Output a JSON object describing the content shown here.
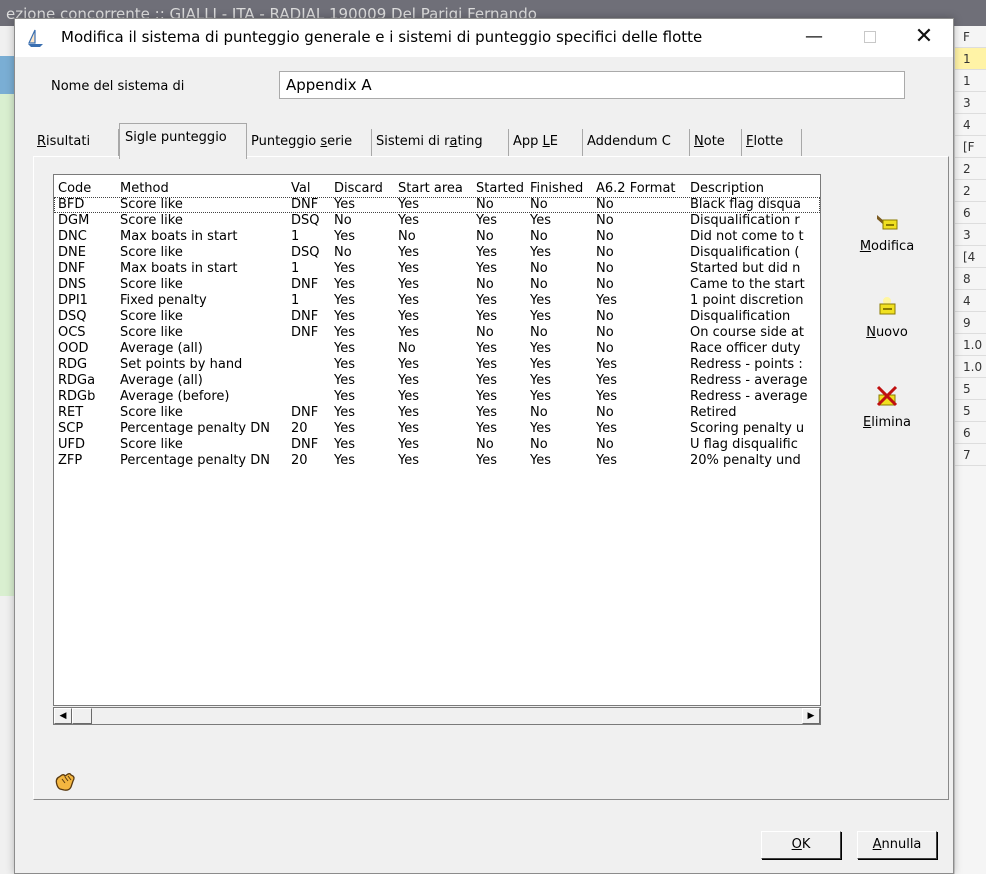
{
  "background": {
    "title": "ezione concorrente :: GIALLI - ITA - RADIAL 190009 Del Parigi Fernando",
    "right_column": [
      "F",
      "1",
      "1",
      "3",
      "4",
      "[F",
      "2",
      "2",
      "6",
      "3",
      "[4",
      "8",
      "4",
      "9",
      "1.0",
      "1.0",
      "5",
      "5",
      "6",
      "7"
    ]
  },
  "dialog": {
    "title": "Modifica il sistema di punteggio generale e i sistemi di punteggio specifici delle flotte",
    "name_label": "Nome del sistema di",
    "name_value": "Appendix A"
  },
  "tabs": [
    {
      "label_pre": "",
      "underline": "R",
      "label_post": "isultati",
      "active": false
    },
    {
      "label_pre": "Sigle punteggio",
      "underline": "",
      "label_post": "",
      "active": true
    },
    {
      "label_pre": "Punteggio ",
      "underline": "s",
      "label_post": "erie",
      "active": false
    },
    {
      "label_pre": "Sistemi di r",
      "underline": "a",
      "label_post": "ting",
      "active": false
    },
    {
      "label_pre": "App ",
      "underline": "L",
      "label_post": "E",
      "active": false
    },
    {
      "label_pre": "Addendum C",
      "underline": "",
      "label_post": "",
      "active": false
    },
    {
      "label_pre": "",
      "underline": "N",
      "label_post": "ote",
      "active": false
    },
    {
      "label_pre": "",
      "underline": "F",
      "label_post": "lotte",
      "active": false
    }
  ],
  "list": {
    "columns": [
      "Code",
      "Method",
      "Val",
      "Discard",
      "Start area",
      "Started",
      "Finished",
      "A6.2 Format",
      "Description"
    ],
    "rows": [
      [
        "BFD",
        "Score like",
        "DNF",
        "Yes",
        "Yes",
        "No",
        "No",
        "No",
        "Black flag disqua"
      ],
      [
        "DGM",
        "Score like",
        "DSQ",
        "No",
        "Yes",
        "Yes",
        "Yes",
        "No",
        "Disqualification r"
      ],
      [
        "DNC",
        "Max boats in start",
        "1",
        "Yes",
        "No",
        "No",
        "No",
        "No",
        "Did not come to t"
      ],
      [
        "DNE",
        "Score like",
        "DSQ",
        "No",
        "Yes",
        "Yes",
        "Yes",
        "No",
        "Disqualification ("
      ],
      [
        "DNF",
        "Max boats in start",
        "1",
        "Yes",
        "Yes",
        "Yes",
        "No",
        "No",
        "Started but did n"
      ],
      [
        "DNS",
        "Score like",
        "DNF",
        "Yes",
        "Yes",
        "No",
        "No",
        "No",
        "Came to the start"
      ],
      [
        "DPI1",
        "Fixed penalty",
        "1",
        "Yes",
        "Yes",
        "Yes",
        "Yes",
        "Yes",
        "1 point discretion"
      ],
      [
        "DSQ",
        "Score like",
        "DNF",
        "Yes",
        "Yes",
        "Yes",
        "Yes",
        "No",
        "Disqualification"
      ],
      [
        "OCS",
        "Score like",
        "DNF",
        "Yes",
        "Yes",
        "No",
        "No",
        "No",
        "On course side at"
      ],
      [
        "OOD",
        "Average (all)",
        "",
        "Yes",
        "No",
        "Yes",
        "Yes",
        "No",
        "Race officer duty"
      ],
      [
        "RDG",
        "Set points by hand",
        "",
        "Yes",
        "Yes",
        "Yes",
        "Yes",
        "Yes",
        "Redress - points :"
      ],
      [
        "RDGa",
        "Average (all)",
        "",
        "Yes",
        "Yes",
        "Yes",
        "Yes",
        "Yes",
        "Redress - average"
      ],
      [
        "RDGb",
        "Average (before)",
        "",
        "Yes",
        "Yes",
        "Yes",
        "Yes",
        "Yes",
        "Redress - average"
      ],
      [
        "RET",
        "Score like",
        "DNF",
        "Yes",
        "Yes",
        "Yes",
        "No",
        "No",
        "Retired"
      ],
      [
        "SCP",
        "Percentage penalty DN",
        "20",
        "Yes",
        "Yes",
        "Yes",
        "Yes",
        "Yes",
        "Scoring penalty u"
      ],
      [
        "UFD",
        "Score like",
        "DNF",
        "Yes",
        "Yes",
        "No",
        "No",
        "No",
        "U flag disqualific"
      ],
      [
        "ZFP",
        "Percentage penalty DN",
        "20",
        "Yes",
        "Yes",
        "Yes",
        "Yes",
        "Yes",
        "20% penalty und"
      ]
    ]
  },
  "buttons": {
    "modify": {
      "pre": "",
      "underline": "M",
      "post": "odifica"
    },
    "new": {
      "pre": "",
      "underline": "N",
      "post": "uovo"
    },
    "delete": {
      "pre": "",
      "underline": "E",
      "post": "limina"
    },
    "ok": {
      "pre": "",
      "underline": "O",
      "post": "K"
    },
    "cancel": {
      "pre": "",
      "underline": "A",
      "post": "nnulla"
    }
  },
  "icons": {
    "app": "sailboat-icon",
    "modify": "edit-card-icon",
    "new": "new-card-icon",
    "delete": "delete-card-icon",
    "help": "hand-icon"
  }
}
